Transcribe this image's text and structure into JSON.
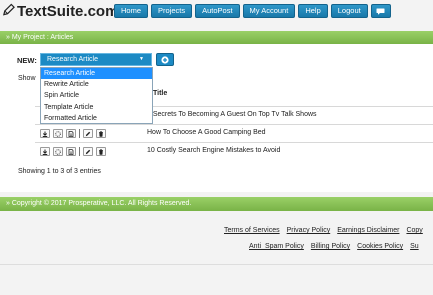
{
  "header": {
    "logo_text": "TextSuite.com",
    "nav": [
      "Home",
      "Projects",
      "AutoPost",
      "My Account",
      "Help",
      "Logout"
    ]
  },
  "breadcrumb": "» My Project : Articles",
  "new_label": "NEW:",
  "select": {
    "value": "Research Article",
    "options": [
      "Research Article",
      "Rewrite Article",
      "Spin Article",
      "Template Article",
      "Formatted Article"
    ]
  },
  "show_label": "Show",
  "table": {
    "title_header": "Title",
    "rows": [
      {
        "title": "5 Secrets To Becoming A Guest On Top Tv Talk Shows"
      },
      {
        "title": "How To Choose A Good Camping Bed"
      },
      {
        "title": "10 Costly Search Engine Mistakes to Avoid"
      }
    ],
    "info": "Showing 1 to 3 of 3 entries"
  },
  "copyright": "» Copyright © 2017 Prosperative, LLC. All Rights Reserved.",
  "footer_links_1": [
    "Terms of Services",
    "Privacy Policy",
    "Earnings Disclaimer",
    "Copy"
  ],
  "footer_links_2": [
    "Anti_Spam Policy",
    "Billing Policy",
    "Cookies Policy",
    "Su"
  ],
  "colors": {
    "nav_blue": "#1878a9",
    "green_bar": "#79b347",
    "selected_option": "#1e90ff"
  }
}
